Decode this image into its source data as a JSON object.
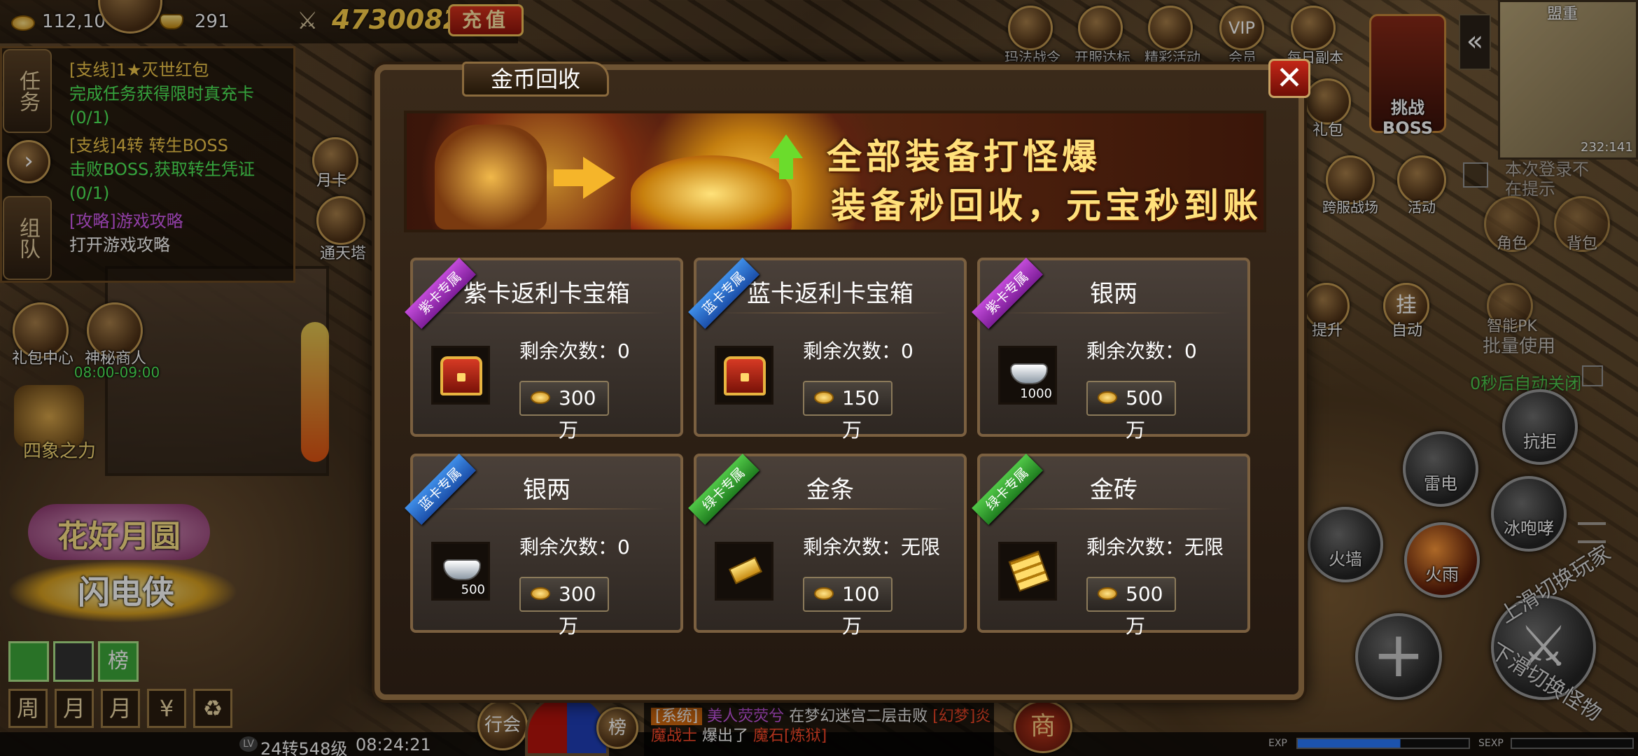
{
  "hud": {
    "gold": "112,10",
    "ingots": "291",
    "power": "4730082",
    "recharge_label": "充值"
  },
  "quest": {
    "tabs": [
      "任务",
      "组队"
    ],
    "lines": [
      {
        "title": "[支线]1★灭世红包",
        "desc": "完成任务获得限时真充卡(0/1)"
      },
      {
        "title": "[支线]4转 转生BOSS",
        "desc": "击败BOSS,获取转生凭证(0/1)"
      },
      {
        "title": "[攻略]游戏攻略",
        "desc": "打开游戏攻略"
      }
    ]
  },
  "left_icons": {
    "gift_center": "礼包中心",
    "mystic_merchant": "神秘商人",
    "merchant_time": "08:00-09:00",
    "four_symbols": "四象之力",
    "tower": "通天塔",
    "moon": "月卡",
    "event_banner": "花好月圆",
    "lightning": "闪电侠"
  },
  "bottom_left_tabs": [
    "周",
    "月",
    "月",
    "¥",
    "♻"
  ],
  "top_icons": [
    "玛法战令",
    "开服达标",
    "精彩活动",
    "会员",
    "每日副本"
  ],
  "right_icons": {
    "challenge_boss": "挑战BOSS",
    "gift": "礼包",
    "cross_server": "跨服战场",
    "activity": "活动",
    "character": "角色",
    "bag": "背包",
    "upgrade": "提升",
    "auto": "自动",
    "smart_pk": "智能PK",
    "batch_use": "批量使用",
    "auto_close": "0秒后自动关闭",
    "login_notice": "本次登录不在提示",
    "map_name": "盟重",
    "coords": "232:141"
  },
  "skills": [
    "抗拒",
    "雷电",
    "冰咆哮",
    "火墙",
    "火雨"
  ],
  "swipe_hints": {
    "up": "上滑切换玩家",
    "down": "下滑切换怪物"
  },
  "dialog": {
    "title": "金币回收",
    "banner_line1": "全部装备打怪爆",
    "banner_line2": "装备秒回收，元宝秒到账",
    "remain_label": "剩余次数：",
    "cards": [
      {
        "name": "紫卡返利卡宝箱",
        "ribbon": "紫卡专属",
        "ribbon_color": "purple",
        "remaining": "0",
        "price": "300万",
        "item": "chest",
        "qty": ""
      },
      {
        "name": "蓝卡返利卡宝箱",
        "ribbon": "蓝卡专属",
        "ribbon_color": "blue",
        "remaining": "0",
        "price": "150万",
        "item": "chest",
        "qty": ""
      },
      {
        "name": "银两",
        "ribbon": "紫卡专属",
        "ribbon_color": "purple",
        "remaining": "0",
        "price": "500万",
        "item": "silver",
        "qty": "1000"
      },
      {
        "name": "银两",
        "ribbon": "蓝卡专属",
        "ribbon_color": "blue",
        "remaining": "0",
        "price": "300万",
        "item": "silver",
        "qty": "500"
      },
      {
        "name": "金条",
        "ribbon": "绿卡专属",
        "ribbon_color": "green",
        "remaining": "无限",
        "price": "100万",
        "item": "goldbar",
        "qty": ""
      },
      {
        "name": "金砖",
        "ribbon": "绿卡专属",
        "ribbon_color": "green",
        "remaining": "无限",
        "price": "500万",
        "item": "goldbrick",
        "qty": ""
      }
    ]
  },
  "bottom": {
    "guild": "行会",
    "rank": "榜",
    "shop": "商",
    "level": "24转548级",
    "time": "08:24:21",
    "exp": "EXP",
    "sexp": "SEXP"
  },
  "chat": {
    "channel": "[系统]",
    "player": "美人荧荧兮",
    "text1": "在梦幻迷宫二层击败",
    "monster": "[幻梦]炎魔战士",
    "text2": "爆出了",
    "item": "魔石[炼狱]"
  }
}
